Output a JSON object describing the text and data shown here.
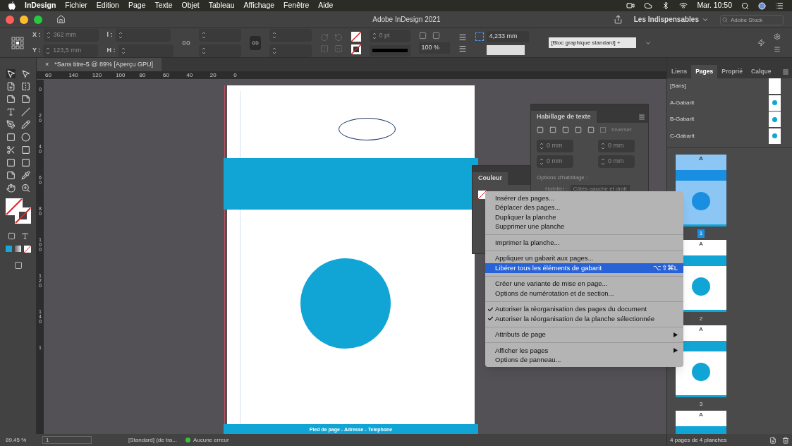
{
  "menubar": {
    "app": "InDesign",
    "items": [
      "Fichier",
      "Edition",
      "Page",
      "Texte",
      "Objet",
      "Tableau",
      "Affichage",
      "Fenêtre",
      "Aide"
    ],
    "clock": "Mar. 10:50"
  },
  "titlebar": {
    "title": "Adobe InDesign 2021",
    "workspace": "Les Indispensables",
    "search": {
      "placeholder": "Adobe Stock"
    }
  },
  "control_panel": {
    "x_label": "X :",
    "x": "362 mm",
    "y_label": "Y :",
    "y": "123,5 mm",
    "w_label": "l :",
    "h_label": "H :",
    "stroke_weight": "0 pt",
    "opacity": "100 %",
    "offset": "4,233 mm",
    "object_style": "[Bloc graphique standard] +"
  },
  "document_tab": {
    "title": "*Sans titre-5 @ 89% [Aperçu GPU]",
    "close": "×"
  },
  "ruler": {
    "horizontal": [
      "60",
      "140",
      "120",
      "100",
      "80",
      "60",
      "40",
      "20",
      "0"
    ],
    "vertical": [
      "0",
      "20",
      "40",
      "60",
      "80",
      "100",
      "120",
      "140",
      "1"
    ]
  },
  "page": {
    "footer": "Pied de page - Adresse - Telephone"
  },
  "wrap_panel": {
    "title": "Habillage de texte",
    "invert": {
      "label": "Inverser",
      "checked": false
    },
    "offsets": [
      "0 mm",
      "0 mm",
      "0 mm",
      "0 mm"
    ],
    "options_label": "Options d'habillage :",
    "wrap_label": "Habiller :",
    "wrap_value": "Côtés gauche et droit"
  },
  "color_panel": {
    "title": "Couleur"
  },
  "context_menu": [
    {
      "kind": "item",
      "label": "Insérer des pages...",
      "selected": false,
      "checked": false
    },
    {
      "kind": "item",
      "label": "Déplacer des pages...",
      "selected": false,
      "checked": false
    },
    {
      "kind": "item",
      "label": "Dupliquer la planche",
      "selected": false,
      "checked": false
    },
    {
      "kind": "item",
      "label": "Supprimer une planche",
      "selected": false,
      "checked": false
    },
    {
      "kind": "separator"
    },
    {
      "kind": "item",
      "label": "Imprimer la planche...",
      "selected": false,
      "checked": false
    },
    {
      "kind": "separator"
    },
    {
      "kind": "item",
      "label": "Appliquer un gabarit aux pages...",
      "selected": false,
      "checked": false
    },
    {
      "kind": "item",
      "label": "Libérer tous les éléments de gabarit",
      "shortcut": "⌥⇧⌘L",
      "selected": true,
      "checked": false
    },
    {
      "kind": "separator"
    },
    {
      "kind": "item",
      "label": "Créer une variante de mise en page...",
      "selected": false,
      "checked": false
    },
    {
      "kind": "item",
      "label": "Options de numérotation et de section...",
      "selected": false,
      "checked": false
    },
    {
      "kind": "separator"
    },
    {
      "kind": "item",
      "label": "Autoriser la réorganisation des pages du document",
      "selected": false,
      "checked": true
    },
    {
      "kind": "item",
      "label": "Autoriser la réorganisation de la planche sélectionnée",
      "selected": false,
      "checked": true
    },
    {
      "kind": "separator"
    },
    {
      "kind": "submenu",
      "label": "Attributs de page",
      "selected": false,
      "checked": false
    },
    {
      "kind": "separator"
    },
    {
      "kind": "submenu",
      "label": "Afficher les pages",
      "selected": false,
      "checked": false
    },
    {
      "kind": "item",
      "label": "Options de panneau...",
      "selected": false,
      "checked": false
    }
  ],
  "pages_panel": {
    "tabs": [
      {
        "label": "Liens",
        "selected": false
      },
      {
        "label": "Pages",
        "selected": true
      },
      {
        "label": "Proprié",
        "selected": false
      },
      {
        "label": "Calque",
        "selected": false
      }
    ],
    "masters": [
      "[Sans]",
      "A-Gabarit",
      "B-Gabarit",
      "C-Gabarit"
    ],
    "pages": [
      {
        "number": "1",
        "master": "A",
        "selected": true
      },
      {
        "number": "2",
        "master": "A",
        "selected": false
      },
      {
        "number": "3",
        "master": "A",
        "selected": false
      },
      {
        "master": "A",
        "selected": false
      }
    ],
    "footer": "4 pages de 4 planches"
  },
  "status_bar": {
    "zoom": "89,45 %",
    "page": "1",
    "mode": "[Standard] (de tra...",
    "preflight": "Aucune erreur"
  }
}
